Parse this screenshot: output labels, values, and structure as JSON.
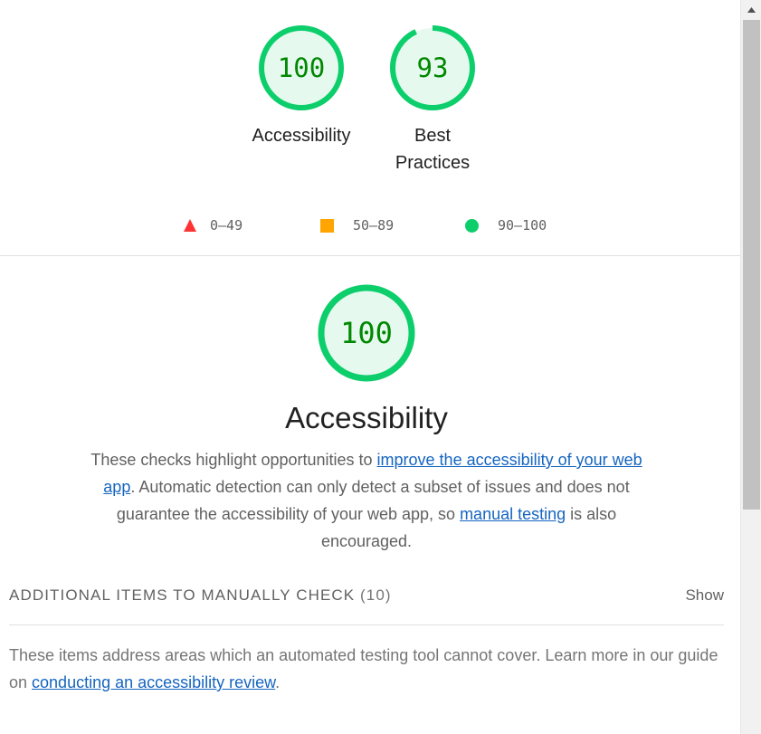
{
  "summary": {
    "gauges": [
      {
        "score": "100",
        "label": "Accessibility",
        "fraction": 1.0
      },
      {
        "score": "93",
        "label_line1": "Best",
        "label_line2": "Practices",
        "fraction": 0.93
      }
    ]
  },
  "legend": {
    "fail": "0–49",
    "average": "50–89",
    "pass": "90–100"
  },
  "colors": {
    "pass_stroke": "#0cce6b",
    "pass_fill": "#e6f9ef",
    "pass_text": "#008800",
    "fail": "#ff3333",
    "average": "#ffa400",
    "link": "#1565c0"
  },
  "category": {
    "score": "100",
    "fraction": 1.0,
    "title": "Accessibility",
    "desc_before": "These checks highlight opportunities to ",
    "desc_link1": "improve the accessibility of your web app",
    "desc_middle": ". Automatic detection can only detect a subset of issues and does not guarantee the accessibility of your web app, so ",
    "desc_link2": "manual testing",
    "desc_after": " is also encouraged."
  },
  "manual": {
    "title": "ADDITIONAL ITEMS TO MANUALLY CHECK",
    "count": "(10)",
    "toggle": "Show",
    "desc_before": "These items address areas which an automated testing tool cannot cover. Learn more in our guide on ",
    "desc_link": "conducting an accessibility review",
    "desc_after": "."
  },
  "scrollbar": {
    "up_icon": "triangle-up"
  }
}
